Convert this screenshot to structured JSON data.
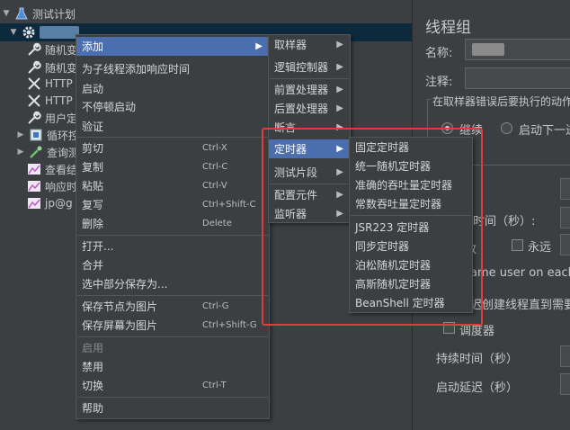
{
  "tree": {
    "root_label": "测试计划",
    "items": [
      {
        "label": "随机变"
      },
      {
        "label": "随机变"
      },
      {
        "label": "HTTP"
      },
      {
        "label": "HTTP"
      },
      {
        "label": "用户定"
      },
      {
        "label": "循环控"
      },
      {
        "label": "查询测"
      },
      {
        "label": "查看结"
      },
      {
        "label": "响应时"
      },
      {
        "label": "jp@g"
      }
    ]
  },
  "props": {
    "title": "线程组",
    "name_label": "名称:",
    "comment_label": "注释:",
    "error_group_title": "在取样器错误后要执行的动作",
    "radio_continue": "继续",
    "radio_next": "启动下一进",
    "ramp_label": "如时间（秒）:",
    "loop_label": "数",
    "forever_label": "永远",
    "same_user": "ame user on each ite",
    "delay_create": "迟创建线程直到需要",
    "scheduler_label": "调度器",
    "duration_label": "持续时间（秒）",
    "startup_delay_label": "启动延迟（秒）"
  },
  "context_menu": {
    "items": [
      {
        "label": "添加",
        "submenu": true,
        "active": true
      },
      {
        "label": "为子线程添加响应时间"
      },
      {
        "label": "启动"
      },
      {
        "label": "不停顿启动"
      },
      {
        "label": "验证"
      },
      {
        "label": "剪切",
        "shortcut": "Ctrl-X"
      },
      {
        "label": "复制",
        "shortcut": "Ctrl-C"
      },
      {
        "label": "粘贴",
        "shortcut": "Ctrl-V"
      },
      {
        "label": "复写",
        "shortcut": "Ctrl+Shift-C"
      },
      {
        "label": "删除",
        "shortcut": "Delete"
      },
      {
        "label": "打开..."
      },
      {
        "label": "合并"
      },
      {
        "label": "选中部分保存为..."
      },
      {
        "label": "保存节点为图片",
        "shortcut": "Ctrl-G"
      },
      {
        "label": "保存屏幕为图片",
        "shortcut": "Ctrl+Shift-G"
      },
      {
        "label": "启用",
        "disabled": true
      },
      {
        "label": "禁用"
      },
      {
        "label": "切换",
        "shortcut": "Ctrl-T"
      },
      {
        "label": "帮助"
      }
    ]
  },
  "add_submenu": {
    "items": [
      {
        "label": "取样器"
      },
      {
        "label": "逻辑控制器"
      },
      {
        "label": "前置处理器"
      },
      {
        "label": "后置处理器"
      },
      {
        "label": "断言"
      },
      {
        "label": "定时器",
        "active": true
      },
      {
        "label": "测试片段"
      },
      {
        "label": "配置元件"
      },
      {
        "label": "监听器"
      }
    ]
  },
  "timer_submenu": {
    "items": [
      {
        "label": "固定定时器"
      },
      {
        "label": "统一随机定时器"
      },
      {
        "label": "准确的吞吐量定时器"
      },
      {
        "label": "常数吞吐量定时器"
      },
      {
        "label": "JSR223 定时器"
      },
      {
        "label": "同步定时器"
      },
      {
        "label": "泊松随机定时器"
      },
      {
        "label": "高斯随机定时器"
      },
      {
        "label": "BeanShell 定时器"
      }
    ]
  },
  "colors": {
    "background": "#3c3f41",
    "menu_active": "#4b6eaf",
    "highlight_box": "#e23b3b"
  }
}
